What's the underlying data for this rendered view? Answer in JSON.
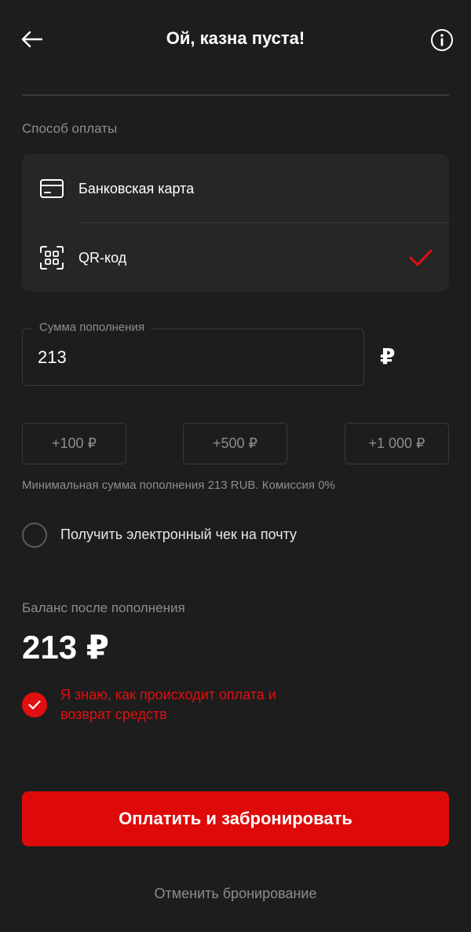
{
  "header": {
    "title": "Ой, казна пуста!",
    "back_icon": "arrow-left-icon",
    "info_icon": "info-icon"
  },
  "payment": {
    "section_label": "Способ оплаты",
    "methods": [
      {
        "label": "Банковская карта",
        "icon": "credit-card-icon",
        "selected": false
      },
      {
        "label": "QR-код",
        "icon": "qr-code-icon",
        "selected": true
      }
    ]
  },
  "amount": {
    "legend": "Сумма пополнения",
    "value": "213",
    "currency": "₽"
  },
  "quick_add": [
    "+100 ₽",
    "+500 ₽",
    "+1 000 ₽"
  ],
  "min_note": "Минимальная сумма пополнения 213 RUB. Комиссия 0%",
  "receipt": {
    "label": "Получить электронный чек на почту",
    "checked": false
  },
  "balance": {
    "label": "Баланс после пополнения",
    "value": "213 ₽"
  },
  "agreement": {
    "text": "Я знаю, как происходит оплата и возврат средств",
    "checked": true
  },
  "actions": {
    "pay_label": "Оплатить и забронировать",
    "cancel_label": "Отменить бронирование"
  },
  "colors": {
    "background": "#1d1d1d",
    "accent": "#de0a0a",
    "card": "#262626",
    "muted_text": "#8d8d8d"
  }
}
